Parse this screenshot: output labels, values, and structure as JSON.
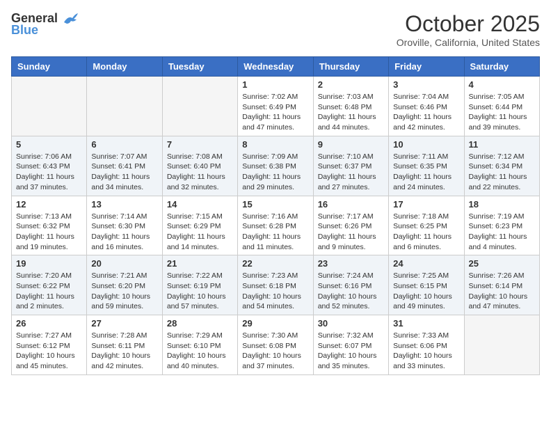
{
  "logo": {
    "line1": "General",
    "line2": "Blue"
  },
  "title": "October 2025",
  "subtitle": "Oroville, California, United States",
  "days_of_week": [
    "Sunday",
    "Monday",
    "Tuesday",
    "Wednesday",
    "Thursday",
    "Friday",
    "Saturday"
  ],
  "weeks": [
    [
      {
        "day": "",
        "info": ""
      },
      {
        "day": "",
        "info": ""
      },
      {
        "day": "",
        "info": ""
      },
      {
        "day": "1",
        "info": "Sunrise: 7:02 AM\nSunset: 6:49 PM\nDaylight: 11 hours and 47 minutes."
      },
      {
        "day": "2",
        "info": "Sunrise: 7:03 AM\nSunset: 6:48 PM\nDaylight: 11 hours and 44 minutes."
      },
      {
        "day": "3",
        "info": "Sunrise: 7:04 AM\nSunset: 6:46 PM\nDaylight: 11 hours and 42 minutes."
      },
      {
        "day": "4",
        "info": "Sunrise: 7:05 AM\nSunset: 6:44 PM\nDaylight: 11 hours and 39 minutes."
      }
    ],
    [
      {
        "day": "5",
        "info": "Sunrise: 7:06 AM\nSunset: 6:43 PM\nDaylight: 11 hours and 37 minutes."
      },
      {
        "day": "6",
        "info": "Sunrise: 7:07 AM\nSunset: 6:41 PM\nDaylight: 11 hours and 34 minutes."
      },
      {
        "day": "7",
        "info": "Sunrise: 7:08 AM\nSunset: 6:40 PM\nDaylight: 11 hours and 32 minutes."
      },
      {
        "day": "8",
        "info": "Sunrise: 7:09 AM\nSunset: 6:38 PM\nDaylight: 11 hours and 29 minutes."
      },
      {
        "day": "9",
        "info": "Sunrise: 7:10 AM\nSunset: 6:37 PM\nDaylight: 11 hours and 27 minutes."
      },
      {
        "day": "10",
        "info": "Sunrise: 7:11 AM\nSunset: 6:35 PM\nDaylight: 11 hours and 24 minutes."
      },
      {
        "day": "11",
        "info": "Sunrise: 7:12 AM\nSunset: 6:34 PM\nDaylight: 11 hours and 22 minutes."
      }
    ],
    [
      {
        "day": "12",
        "info": "Sunrise: 7:13 AM\nSunset: 6:32 PM\nDaylight: 11 hours and 19 minutes."
      },
      {
        "day": "13",
        "info": "Sunrise: 7:14 AM\nSunset: 6:30 PM\nDaylight: 11 hours and 16 minutes."
      },
      {
        "day": "14",
        "info": "Sunrise: 7:15 AM\nSunset: 6:29 PM\nDaylight: 11 hours and 14 minutes."
      },
      {
        "day": "15",
        "info": "Sunrise: 7:16 AM\nSunset: 6:28 PM\nDaylight: 11 hours and 11 minutes."
      },
      {
        "day": "16",
        "info": "Sunrise: 7:17 AM\nSunset: 6:26 PM\nDaylight: 11 hours and 9 minutes."
      },
      {
        "day": "17",
        "info": "Sunrise: 7:18 AM\nSunset: 6:25 PM\nDaylight: 11 hours and 6 minutes."
      },
      {
        "day": "18",
        "info": "Sunrise: 7:19 AM\nSunset: 6:23 PM\nDaylight: 11 hours and 4 minutes."
      }
    ],
    [
      {
        "day": "19",
        "info": "Sunrise: 7:20 AM\nSunset: 6:22 PM\nDaylight: 11 hours and 2 minutes."
      },
      {
        "day": "20",
        "info": "Sunrise: 7:21 AM\nSunset: 6:20 PM\nDaylight: 10 hours and 59 minutes."
      },
      {
        "day": "21",
        "info": "Sunrise: 7:22 AM\nSunset: 6:19 PM\nDaylight: 10 hours and 57 minutes."
      },
      {
        "day": "22",
        "info": "Sunrise: 7:23 AM\nSunset: 6:18 PM\nDaylight: 10 hours and 54 minutes."
      },
      {
        "day": "23",
        "info": "Sunrise: 7:24 AM\nSunset: 6:16 PM\nDaylight: 10 hours and 52 minutes."
      },
      {
        "day": "24",
        "info": "Sunrise: 7:25 AM\nSunset: 6:15 PM\nDaylight: 10 hours and 49 minutes."
      },
      {
        "day": "25",
        "info": "Sunrise: 7:26 AM\nSunset: 6:14 PM\nDaylight: 10 hours and 47 minutes."
      }
    ],
    [
      {
        "day": "26",
        "info": "Sunrise: 7:27 AM\nSunset: 6:12 PM\nDaylight: 10 hours and 45 minutes."
      },
      {
        "day": "27",
        "info": "Sunrise: 7:28 AM\nSunset: 6:11 PM\nDaylight: 10 hours and 42 minutes."
      },
      {
        "day": "28",
        "info": "Sunrise: 7:29 AM\nSunset: 6:10 PM\nDaylight: 10 hours and 40 minutes."
      },
      {
        "day": "29",
        "info": "Sunrise: 7:30 AM\nSunset: 6:08 PM\nDaylight: 10 hours and 37 minutes."
      },
      {
        "day": "30",
        "info": "Sunrise: 7:32 AM\nSunset: 6:07 PM\nDaylight: 10 hours and 35 minutes."
      },
      {
        "day": "31",
        "info": "Sunrise: 7:33 AM\nSunset: 6:06 PM\nDaylight: 10 hours and 33 minutes."
      },
      {
        "day": "",
        "info": ""
      }
    ]
  ]
}
